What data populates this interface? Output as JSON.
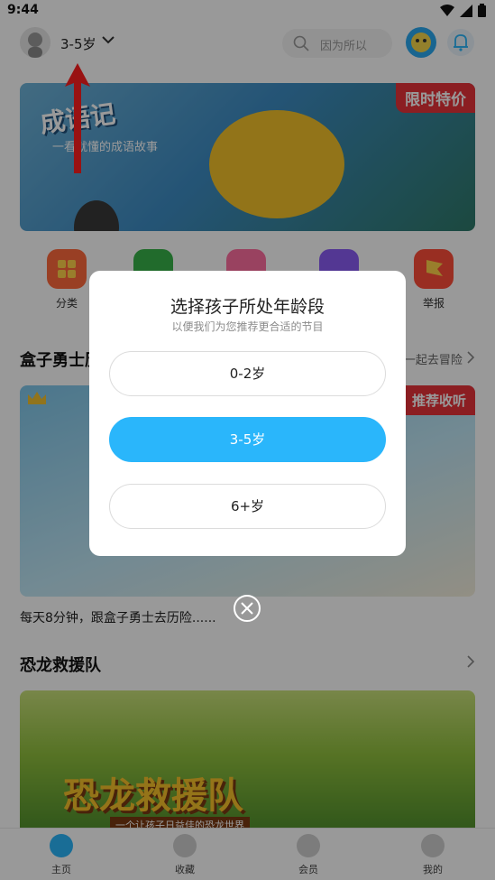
{
  "status_bar": {
    "time": "9:44"
  },
  "header": {
    "age_label": "3-5岁",
    "search_placeholder": "因为所以"
  },
  "banner": {
    "tag": "限时特价",
    "title": "成语记",
    "subtitle": "一看就懂的成语故事"
  },
  "categories": [
    {
      "label": "分类",
      "color": "#ff6a3d"
    },
    {
      "label": "",
      "color": "#38b34a"
    },
    {
      "label": "",
      "color": "#ff6fa0"
    },
    {
      "label": "",
      "color": "#8a5cf5"
    },
    {
      "label": "举报",
      "color": "#ff4e3a"
    }
  ],
  "sections": {
    "box_title": "盒子勇士历",
    "box_more": "一起去冒险",
    "box_tag": "推荐收听",
    "box_caption": "每天8分钟，跟盒子勇士去历险......",
    "dino_title": "恐龙救援队",
    "dino_card_title": "恐龙救援队",
    "dino_card_sub": "一个让孩子日益佳的恐龙世界"
  },
  "dialog": {
    "title": "选择孩子所处年龄段",
    "subtitle": "以便我们为您推荐更合适的节目",
    "options": [
      "0-2岁",
      "3-5岁",
      "6+岁"
    ],
    "selected_index": 1
  },
  "tabs": [
    "主页",
    "收藏",
    "会员",
    "我的"
  ],
  "colors": {
    "accent": "#2ab6fb",
    "promo_red": "#e8323a"
  }
}
